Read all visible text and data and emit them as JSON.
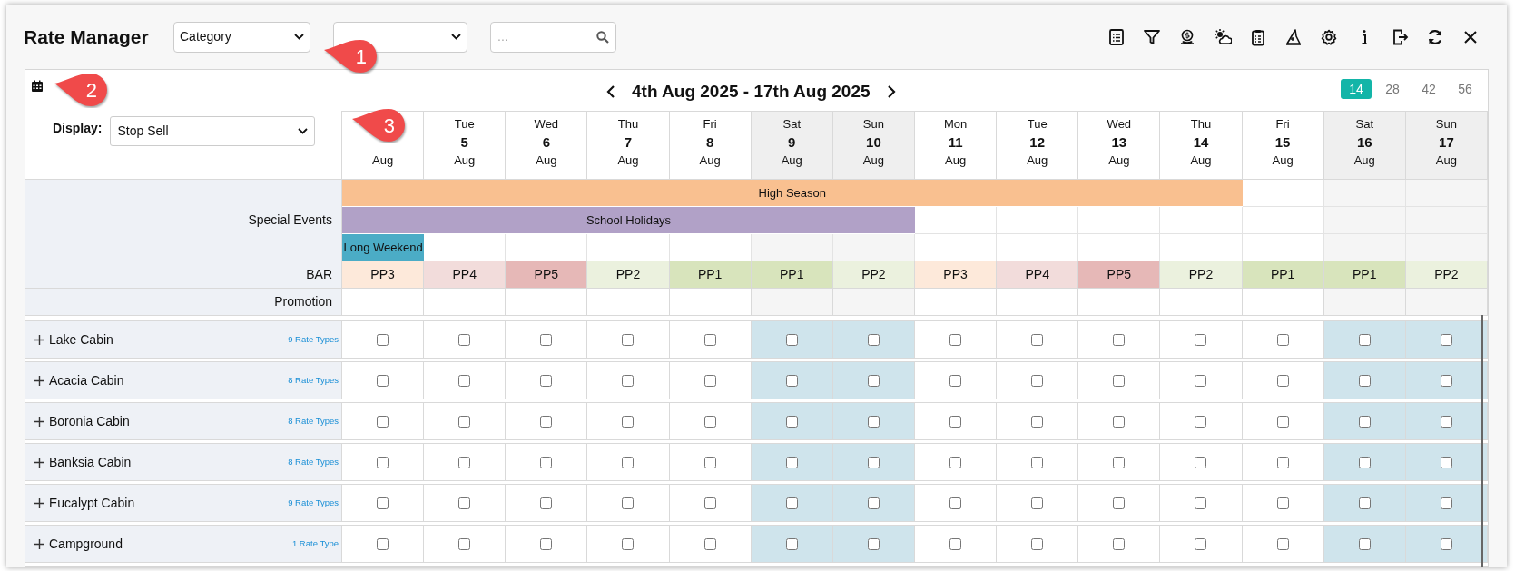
{
  "title": "Rate Manager",
  "filters": [
    {
      "kind": "select",
      "value": "Category"
    },
    {
      "kind": "select"
    },
    {
      "kind": "search",
      "placeholder": "..."
    }
  ],
  "date_range": "4th Aug 2025 - 17th Aug 2025",
  "range_options": [
    {
      "label": "14",
      "selected": true
    },
    {
      "label": "28",
      "selected": false
    },
    {
      "label": "42",
      "selected": false
    },
    {
      "label": "56",
      "selected": false
    }
  ],
  "display": {
    "label": "Display:",
    "value": "Stop Sell"
  },
  "days": [
    {
      "month": "Aug",
      "weekend": false,
      "bar": {
        "label": "PP3",
        "color": "#fde9da"
      }
    },
    {
      "weekday": "Tue",
      "date": "5",
      "month": "Aug",
      "weekend": false,
      "bar": {
        "label": "PP4",
        "color": "#f2dcdb"
      }
    },
    {
      "weekday": "Wed",
      "date": "6",
      "month": "Aug",
      "weekend": false,
      "bar": {
        "label": "PP5",
        "color": "#e6b8b7"
      }
    },
    {
      "weekday": "Thu",
      "date": "7",
      "month": "Aug",
      "weekend": false,
      "bar": {
        "label": "PP2",
        "color": "#ebf1de"
      }
    },
    {
      "weekday": "Fri",
      "date": "8",
      "month": "Aug",
      "weekend": false,
      "bar": {
        "label": "PP1",
        "color": "#d8e4bc"
      }
    },
    {
      "weekday": "Sat",
      "date": "9",
      "month": "Aug",
      "weekend": true,
      "bar": {
        "label": "PP1",
        "color": "#d8e4bc"
      }
    },
    {
      "weekday": "Sun",
      "date": "10",
      "month": "Aug",
      "weekend": true,
      "bar": {
        "label": "PP2",
        "color": "#ebf1de"
      }
    },
    {
      "weekday": "Mon",
      "date": "11",
      "month": "Aug",
      "weekend": false,
      "bar": {
        "label": "PP3",
        "color": "#fde9da"
      }
    },
    {
      "weekday": "Tue",
      "date": "12",
      "month": "Aug",
      "weekend": false,
      "bar": {
        "label": "PP4",
        "color": "#f2dcdb"
      }
    },
    {
      "weekday": "Wed",
      "date": "13",
      "month": "Aug",
      "weekend": false,
      "bar": {
        "label": "PP5",
        "color": "#e6b8b7"
      }
    },
    {
      "weekday": "Thu",
      "date": "14",
      "month": "Aug",
      "weekend": false,
      "bar": {
        "label": "PP2",
        "color": "#ebf1de"
      }
    },
    {
      "weekday": "Fri",
      "date": "15",
      "month": "Aug",
      "weekend": false,
      "bar": {
        "label": "PP1",
        "color": "#d8e4bc"
      }
    },
    {
      "weekday": "Sat",
      "date": "16",
      "month": "Aug",
      "weekend": true,
      "bar": {
        "label": "PP1",
        "color": "#d8e4bc"
      }
    },
    {
      "weekday": "Sun",
      "date": "17",
      "month": "Aug",
      "weekend": true,
      "bar": {
        "label": "PP2",
        "color": "#ebf1de"
      }
    }
  ],
  "special_events": {
    "label": "Special Events",
    "events": [
      {
        "label": "High Season",
        "color": "#f9c090",
        "covers": [
          true,
          true,
          true,
          true,
          true,
          true,
          true,
          true,
          true,
          true,
          true,
          false,
          false,
          false
        ]
      },
      {
        "label": "School Holidays",
        "color": "#b1a1c7",
        "covers": [
          true,
          true,
          true,
          true,
          true,
          true,
          true,
          false,
          false,
          false,
          false,
          false,
          false,
          false
        ]
      },
      {
        "label": "Long Weekend",
        "color": "#4bacc6",
        "covers": [
          true,
          false,
          false,
          false,
          false,
          false,
          false,
          false,
          false,
          false,
          false,
          false,
          false,
          false
        ]
      }
    ]
  },
  "bar_label": "BAR",
  "promotion_label": "Promotion",
  "rooms": [
    {
      "name": "Lake Cabin",
      "rate_types": "9 Rate Types",
      "stop_sell": [
        false,
        false,
        false,
        false,
        false,
        false,
        false,
        false,
        false,
        false,
        false,
        false,
        false,
        false
      ]
    },
    {
      "name": "Acacia Cabin",
      "rate_types": "8 Rate Types",
      "stop_sell": [
        false,
        false,
        false,
        false,
        false,
        false,
        false,
        false,
        false,
        false,
        false,
        false,
        false,
        false
      ]
    },
    {
      "name": "Boronia Cabin",
      "rate_types": "8 Rate Types",
      "stop_sell": [
        false,
        false,
        false,
        false,
        false,
        false,
        false,
        false,
        false,
        false,
        false,
        false,
        false,
        false
      ]
    },
    {
      "name": "Banksia Cabin",
      "rate_types": "8 Rate Types",
      "stop_sell": [
        false,
        false,
        false,
        false,
        false,
        false,
        false,
        false,
        false,
        false,
        false,
        false,
        false,
        false
      ]
    },
    {
      "name": "Eucalypt Cabin",
      "rate_types": "9 Rate Types",
      "stop_sell": [
        false,
        false,
        false,
        false,
        false,
        false,
        false,
        false,
        false,
        false,
        false,
        false,
        false,
        false
      ]
    },
    {
      "name": "Campground",
      "rate_types": "1 Rate Type",
      "stop_sell": [
        false,
        false,
        false,
        false,
        false,
        false,
        false,
        false,
        false,
        false,
        false,
        false,
        false,
        false
      ]
    }
  ],
  "callouts": [
    {
      "label": "1"
    },
    {
      "label": "2"
    },
    {
      "label": "3"
    }
  ]
}
